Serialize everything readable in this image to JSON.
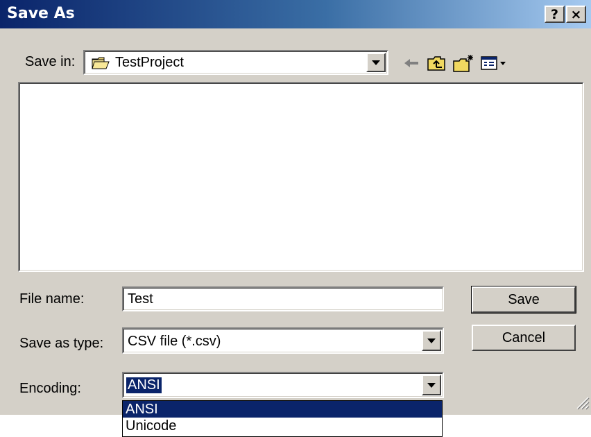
{
  "window": {
    "title": "Save As",
    "help_label": "?",
    "close_label": "×"
  },
  "toolbar": {
    "save_in_label": "Save in:",
    "save_in_value": "TestProject",
    "icons": [
      "back-arrow-icon",
      "up-folder-icon",
      "new-folder-icon",
      "view-menu-icon"
    ]
  },
  "form": {
    "file_name_label": "File name:",
    "file_name_value": "Test",
    "save_as_type_label": "Save as type:",
    "save_as_type_value": "CSV file (*.csv)",
    "encoding_label": "Encoding:",
    "encoding_value": "ANSI"
  },
  "buttons": {
    "save": "Save",
    "cancel": "Cancel"
  },
  "encoding_options": [
    "ANSI",
    "Unicode"
  ],
  "colors": {
    "title_start": "#0a246a",
    "title_end": "#a6caf0",
    "dialog_face": "#d4d0c8",
    "selection": "#0a246a"
  }
}
